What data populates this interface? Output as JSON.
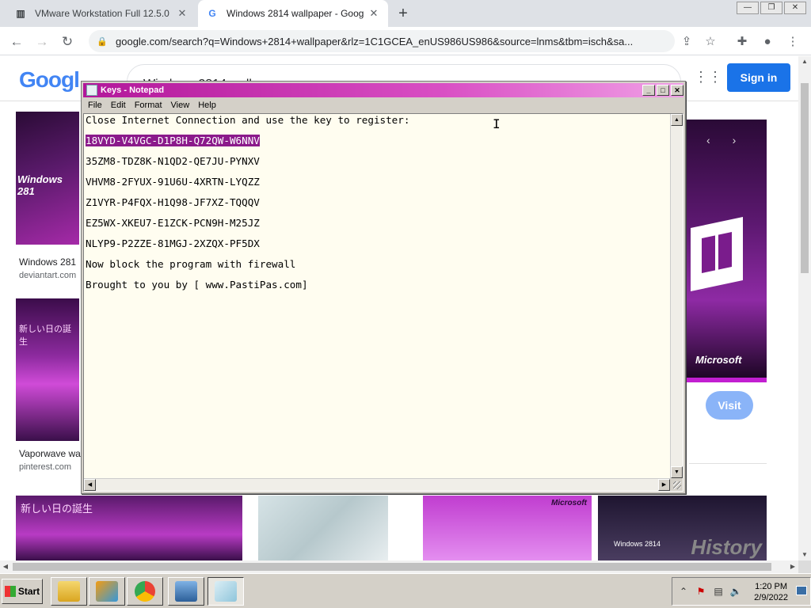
{
  "browser": {
    "tabs": [
      {
        "title": "VMware Workstation Full 12.5.0",
        "icon": "vmware-favicon",
        "close": "✕"
      },
      {
        "title": "Windows 2814 wallpaper - Goog",
        "icon": "google-favicon",
        "close": "✕"
      }
    ],
    "new_tab": "+",
    "url": "google.com/search?q=Windows+2814+wallpaper&rlz=1C1GCEA_enUS986US986&source=lnms&tbm=isch&sa...",
    "window_buttons": [
      "—",
      "❐",
      "✕"
    ]
  },
  "google": {
    "logo": "Googl",
    "search_value": "Windows 2814 wallpaper",
    "sign_in": "Sign in",
    "results": [
      {
        "caption": "Windows 281",
        "source": "deviantart.com",
        "thumb_text": "Windows 281"
      },
      {
        "caption": "Vaporwave wa",
        "source": "pinterest.com",
        "thumb_text": "新しい日の誕生"
      }
    ],
    "preview": {
      "brand": "Microsoft"
    },
    "visit": "Visit",
    "bottom_row": [
      {
        "text": "新しい日の誕生"
      },
      {
        "text": ""
      },
      {
        "text": "Microsoft"
      },
      {
        "text": "Windows 2814",
        "overlay": "History"
      }
    ]
  },
  "notepad": {
    "title": "Keys - Notepad",
    "menu": [
      "File",
      "Edit",
      "Format",
      "View",
      "Help"
    ],
    "lines": [
      "Close Internet Connection and use the key to register:",
      "18VYD-V4VGC-D1P8H-Q72QW-W6NNV",
      "35ZM8-TDZ8K-N1QD2-QE7JU-PYNXV",
      "VHVM8-2FYUX-91U6U-4XRTN-LYQZZ",
      "Z1VYR-P4FQX-H1Q98-JF7XZ-TQQQV",
      "EZ5WX-XKEU7-E1ZCK-PCN9H-M25JZ",
      "NLYP9-P2ZZE-81MGJ-2XZQX-PF5DX",
      "Now block the program with firewall",
      "Brought to you by [ www.PastiPas.com]"
    ],
    "selected_line_index": 1
  },
  "taskbar": {
    "start": "Start",
    "time": "1:20 PM",
    "date": "2/9/2022",
    "apps": [
      "explorer-icon",
      "media-player-icon",
      "chrome-icon",
      "network-icon",
      "notepad-icon"
    ]
  }
}
